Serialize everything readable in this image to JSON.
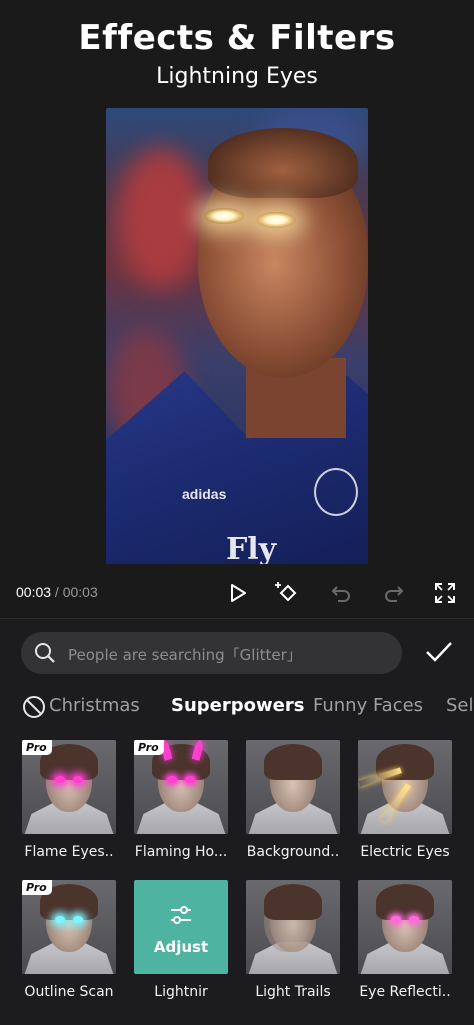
{
  "header": {
    "title": "Effects & Filters",
    "subtitle": "Lightning Eyes"
  },
  "preview": {
    "jersey_brand": "adidas",
    "jersey_text": "Fly"
  },
  "playback": {
    "current_time": "00:03",
    "separator": " / ",
    "duration": "00:03",
    "icons": [
      "play-icon",
      "keyframe-add-icon",
      "undo-icon",
      "redo-icon",
      "fullscreen-icon"
    ]
  },
  "search": {
    "placeholder": "People are searching「Glitter」",
    "icon": "search-icon",
    "confirm_icon": "checkmark-icon"
  },
  "categories": {
    "none_icon": "no-effect-icon",
    "items": [
      {
        "label": "Christmas",
        "active": false
      },
      {
        "label": "Superpowers",
        "active": true
      },
      {
        "label": "Funny Faces",
        "active": false
      },
      {
        "label": "Selfie",
        "active": false
      }
    ]
  },
  "effects": [
    {
      "label": "Flame Eyes..",
      "pro": true
    },
    {
      "label": "Flaming Ho...",
      "pro": true
    },
    {
      "label": "Background..",
      "pro": false
    },
    {
      "label": "Electric Eyes",
      "pro": false
    },
    {
      "label": "Outline Scan",
      "pro": true
    },
    {
      "label": "Lightnir",
      "pro": false,
      "adjust": "Adjust"
    },
    {
      "label": "Light Trails",
      "pro": false
    },
    {
      "label": "Eye Reflecti..",
      "pro": false
    }
  ],
  "pro_badge": "Pro",
  "colors": {
    "background": "#1a1a1a",
    "panel": "#1c1c1e",
    "search_bg": "#333335",
    "adjust_teal": "#4fb3a2",
    "pink_glow": "#ff3fd0",
    "cyan_glow": "#7ff3ff"
  }
}
